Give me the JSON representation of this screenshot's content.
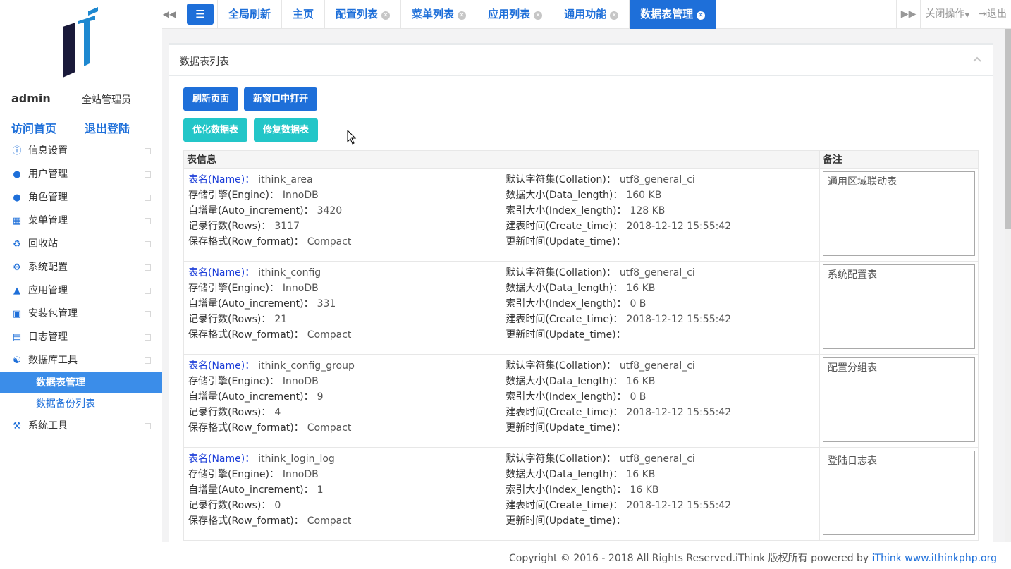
{
  "sidebar": {
    "user_name": "admin",
    "user_role": "全站管理员",
    "links": {
      "home": "访问首页",
      "logout": "退出登陆"
    },
    "menu": [
      {
        "label": "信息设置",
        "icon": "info-circle-icon"
      },
      {
        "label": "用户管理",
        "icon": "user-icon"
      },
      {
        "label": "角色管理",
        "icon": "users-icon"
      },
      {
        "label": "菜单管理",
        "icon": "grid-icon"
      },
      {
        "label": "回收站",
        "icon": "recycle-icon"
      },
      {
        "label": "系统配置",
        "icon": "cogs-icon"
      },
      {
        "label": "应用管理",
        "icon": "app-icon"
      },
      {
        "label": "安装包管理",
        "icon": "briefcase-icon"
      },
      {
        "label": "日志管理",
        "icon": "file-icon"
      },
      {
        "label": "数据库工具",
        "icon": "database-icon"
      }
    ],
    "submenu": [
      "数据表管理",
      "数据备份列表"
    ],
    "last_item": {
      "label": "系统工具",
      "icon": "gavel-icon"
    }
  },
  "topbar": {
    "tabs": [
      {
        "label": "全局刷新",
        "closable": false
      },
      {
        "label": "主页",
        "closable": false
      },
      {
        "label": "配置列表",
        "closable": true
      },
      {
        "label": "菜单列表",
        "closable": true
      },
      {
        "label": "应用列表",
        "closable": true
      },
      {
        "label": "通用功能",
        "closable": true
      },
      {
        "label": "数据表管理",
        "closable": true,
        "active": true
      }
    ],
    "close_ops": "关闭操作",
    "exit": "退出"
  },
  "panel": {
    "title": "数据表列表",
    "buttons": {
      "refresh": "刷新页面",
      "new_window": "新窗口中打开",
      "optimize": "优化数据表",
      "repair": "修复数据表"
    },
    "headers": {
      "info": "表信息",
      "detail": "",
      "note": "备注"
    }
  },
  "labels": {
    "name": "表名(Name)：",
    "engine": "存储引擎(Engine)：",
    "auto_increment": "自增量(Auto_increment)：",
    "rows": "记录行数(Rows)：",
    "row_format": "保存格式(Row_format)：",
    "collation": "默认字符集(Collation)：",
    "data_length": "数据大小(Data_length)：",
    "index_length": "索引大小(Index_length)：",
    "create_time": "建表时间(Create_time)：",
    "update_time": "更新时间(Update_time)："
  },
  "tables": [
    {
      "name": "ithink_area",
      "engine": "InnoDB",
      "auto_increment": "3420",
      "rows": "3117",
      "row_format": "Compact",
      "collation": "utf8_general_ci",
      "data_length": "160 KB",
      "index_length": "128 KB",
      "create_time": "2018-12-12 15:55:42",
      "update_time": "",
      "note": "通用区域联动表"
    },
    {
      "name": "ithink_config",
      "engine": "InnoDB",
      "auto_increment": "331",
      "rows": "21",
      "row_format": "Compact",
      "collation": "utf8_general_ci",
      "data_length": "16 KB",
      "index_length": "0 B",
      "create_time": "2018-12-12 15:55:42",
      "update_time": "",
      "note": "系统配置表"
    },
    {
      "name": "ithink_config_group",
      "engine": "InnoDB",
      "auto_increment": "9",
      "rows": "4",
      "row_format": "Compact",
      "collation": "utf8_general_ci",
      "data_length": "16 KB",
      "index_length": "0 B",
      "create_time": "2018-12-12 15:55:42",
      "update_time": "",
      "note": "配置分组表"
    },
    {
      "name": "ithink_login_log",
      "engine": "InnoDB",
      "auto_increment": "1",
      "rows": "0",
      "row_format": "Compact",
      "collation": "utf8_general_ci",
      "data_length": "16 KB",
      "index_length": "16 KB",
      "create_time": "2018-12-12 15:55:42",
      "update_time": "",
      "note": "登陆日志表"
    }
  ],
  "footer": {
    "text": "Copyright © 2016 - 2018 All Rights Reserved.iThink 版权所有 powered by ",
    "brand": "iThink www.ithinkphp.org"
  },
  "colors": {
    "primary": "#1e6fd9",
    "teal": "#23c6c8",
    "active_menu": "#3b8de9"
  }
}
